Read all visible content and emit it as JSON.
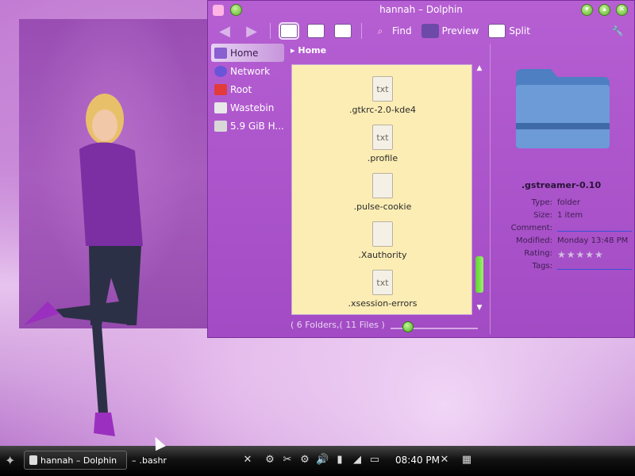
{
  "window": {
    "title": "hannah – Dolphin"
  },
  "toolbar": {
    "find_label": "Find",
    "preview_label": "Preview",
    "split_label": "Split"
  },
  "places": [
    {
      "label": "Home",
      "icon": "home-icon"
    },
    {
      "label": "Network",
      "icon": "network-icon"
    },
    {
      "label": "Root",
      "icon": "root-icon"
    },
    {
      "label": "Wastebin",
      "icon": "trash-icon"
    },
    {
      "label": "5.9 GiB H...",
      "icon": "drive-icon"
    }
  ],
  "breadcrumb": {
    "label": "Home"
  },
  "files": [
    {
      "name": ".gtkrc-2.0-kde4",
      "icon": "text-file-icon",
      "glyph": "txt"
    },
    {
      "name": ".profile",
      "icon": "text-file-icon",
      "glyph": "txt"
    },
    {
      "name": ".pulse-cookie",
      "icon": "binary-file-icon",
      "glyph": ""
    },
    {
      "name": ".Xauthority",
      "icon": "binary-file-icon",
      "glyph": ""
    },
    {
      "name": ".xsession-errors",
      "icon": "text-file-icon",
      "glyph": "txt"
    }
  ],
  "status": {
    "folders": "6 Folders,",
    "files": "11 Files"
  },
  "info_panel": {
    "name": ".gstreamer-0.10",
    "rows": [
      {
        "key": "Type:",
        "value": "folder",
        "link": false
      },
      {
        "key": "Size:",
        "value": "1 item",
        "link": false
      },
      {
        "key": "Comment:",
        "value": "",
        "link": true
      },
      {
        "key": "Modified:",
        "value": "Monday 13:48 PM",
        "link": false
      },
      {
        "key": "Rating:",
        "value": "★★★★★",
        "link": false
      },
      {
        "key": "Tags:",
        "value": "",
        "link": true
      }
    ]
  },
  "taskbar": {
    "tasks": [
      {
        "label": "hannah – Dolphin"
      },
      {
        "label": ".bashr"
      }
    ],
    "clock": "08:40 PM"
  },
  "colors": {
    "accent": "#a24bc4",
    "file_view_bg": "#fcedb4",
    "scroll_thumb": "#5fd32f"
  }
}
